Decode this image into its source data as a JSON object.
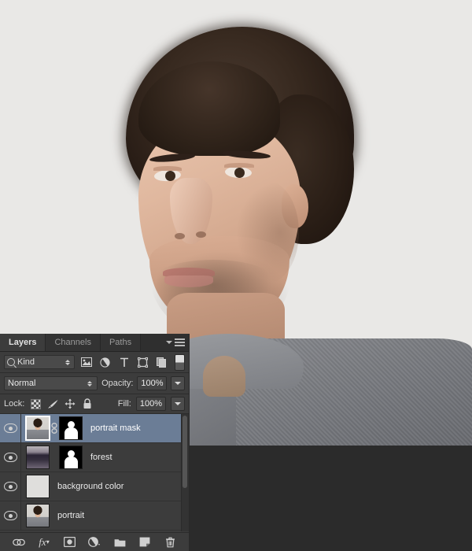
{
  "app": {
    "background_color": "#2b2b2b",
    "canvas_background": "#e9e8e6"
  },
  "panel": {
    "title": "Layers",
    "tabs": [
      {
        "label": "Layers",
        "active": true
      },
      {
        "label": "Channels",
        "active": false
      },
      {
        "label": "Paths",
        "active": false
      }
    ],
    "menu_icon": "panel-menu-icon",
    "selected_row_color": "#6b7d96",
    "panel_background": "#3c3c3c",
    "filter": {
      "kind_label": "Kind",
      "search_icon": "search-icon",
      "icons": [
        {
          "name": "filter-pixel-layers-icon",
          "glyph": "⛰"
        },
        {
          "name": "filter-adjustment-layers-icon",
          "glyph": "◑"
        },
        {
          "name": "filter-type-layers-icon",
          "glyph": "T"
        },
        {
          "name": "filter-shape-layers-icon",
          "glyph": "⬚"
        },
        {
          "name": "filter-smart-object-layers-icon",
          "glyph": "❐"
        }
      ],
      "toggle_name": "filter-enable-toggle"
    },
    "blend": {
      "mode": "Normal",
      "opacity_label": "Opacity:",
      "opacity_value": "100%"
    },
    "lock": {
      "label": "Lock:",
      "icons": [
        {
          "name": "lock-transparent-pixels-icon"
        },
        {
          "name": "lock-image-pixels-icon",
          "glyph": "✎"
        },
        {
          "name": "lock-position-icon",
          "glyph": "✥"
        },
        {
          "name": "lock-all-icon",
          "glyph": "🔒"
        }
      ],
      "fill_label": "Fill:",
      "fill_value": "100%"
    },
    "layers": [
      {
        "name": "portrait mask",
        "visible": true,
        "selected": true,
        "thumb_kind": "portrait",
        "has_mask": true,
        "linked": true
      },
      {
        "name": "forest",
        "visible": true,
        "selected": false,
        "thumb_kind": "forest",
        "has_mask": true,
        "linked": false
      },
      {
        "name": "background color",
        "visible": true,
        "selected": false,
        "thumb_kind": "solid",
        "has_mask": false,
        "linked": false
      },
      {
        "name": "portrait",
        "visible": true,
        "selected": false,
        "thumb_kind": "portrait",
        "has_mask": false,
        "linked": false
      }
    ],
    "bottom_buttons": [
      {
        "name": "link-layers-button",
        "glyph": "⚭"
      },
      {
        "name": "add-layer-style-button",
        "glyph": "fx"
      },
      {
        "name": "add-layer-mask-button",
        "glyph": "▣"
      },
      {
        "name": "new-fill-adjustment-layer-button",
        "glyph": "◑"
      },
      {
        "name": "new-group-button",
        "glyph": "📁"
      },
      {
        "name": "new-layer-button",
        "glyph": "❐"
      },
      {
        "name": "delete-layer-button",
        "glyph": "🗑"
      }
    ]
  }
}
